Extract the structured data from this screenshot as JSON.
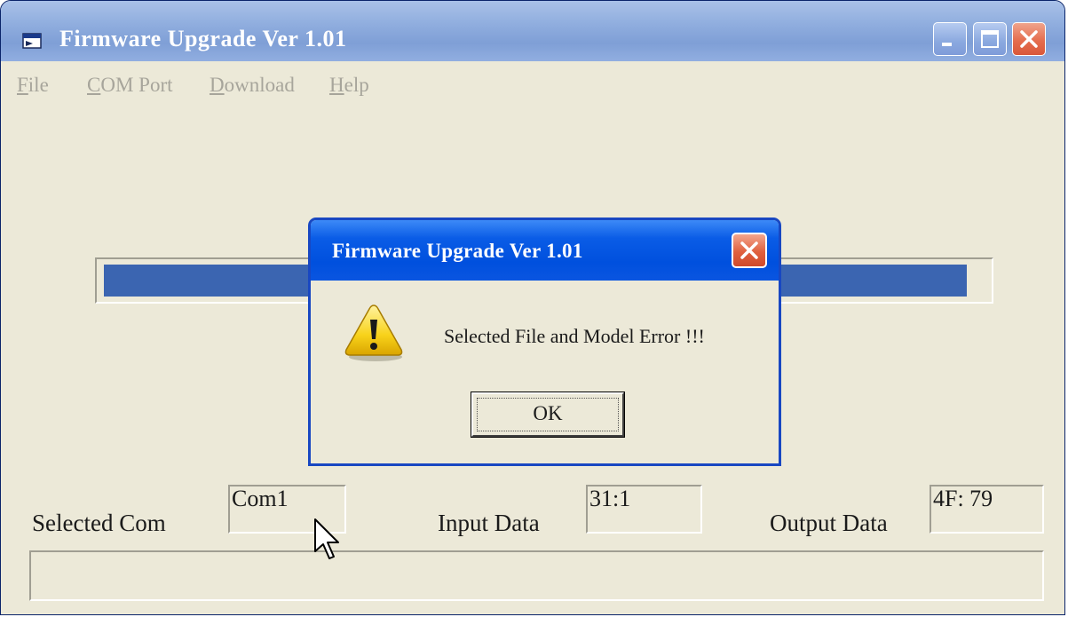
{
  "window": {
    "title": "Firmware Upgrade Ver 1.01",
    "icon": "app-window-icon"
  },
  "menu": {
    "file": {
      "accel": "F",
      "rest": "ile"
    },
    "com_port": {
      "accel": "C",
      "rest": "OM Port"
    },
    "download": {
      "accel": "D",
      "rest": "ownload"
    },
    "help": {
      "accel": "H",
      "rest": "elp"
    }
  },
  "progress": {
    "fraction": 0.98
  },
  "fields": {
    "selected_com_label": "Selected Com",
    "selected_com_value": "Com1",
    "input_data_label": "Input Data",
    "input_data_value": "31:1",
    "output_data_label": "Output Data",
    "output_data_value": "4F: 79"
  },
  "status_bar": {
    "text": ""
  },
  "dialog": {
    "title": "Firmware Upgrade Ver 1.01",
    "icon": "warning-icon",
    "message": "Selected File and Model Error !!!",
    "ok_label": "OK"
  },
  "colors": {
    "window_bg": "#ece9d8",
    "progress_fill": "#3b65b1",
    "dialog_title_blue": "#0050de",
    "close_red": "#e0603e"
  }
}
